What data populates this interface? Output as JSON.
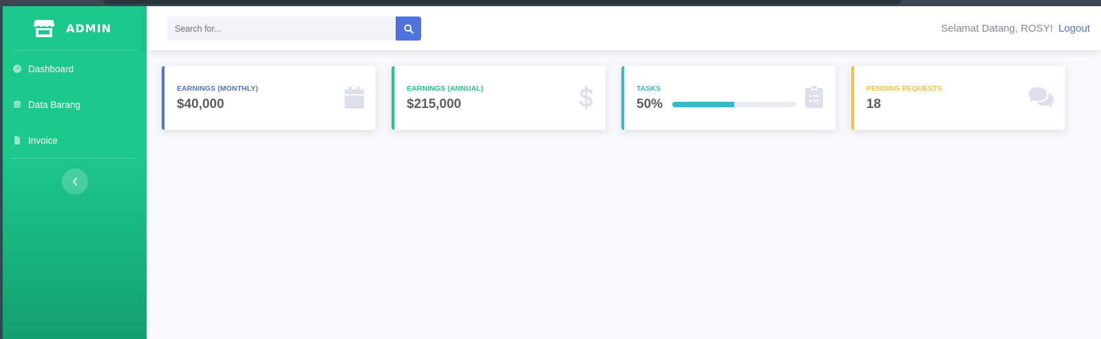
{
  "sidebar": {
    "brand": "ADMIN",
    "brand_icon": "store-icon",
    "items": [
      {
        "label": "Dashboard",
        "icon": "tachometer-icon"
      },
      {
        "label": "Data Barang",
        "icon": "database-icon"
      },
      {
        "label": "Invoice",
        "icon": "file-icon"
      }
    ],
    "toggle_icon": "chevron-left-icon",
    "gradient_colors": [
      "#1cc88a",
      "#13a06e"
    ]
  },
  "topbar": {
    "search": {
      "placeholder": "Search for...",
      "value": "",
      "icon": "search-icon"
    },
    "welcome": "Selamat Datang, ROSY!",
    "logout": "Logout"
  },
  "cards": [
    {
      "label": "Earnings (Monthly)",
      "value": "$40,000",
      "color": "#4e73df",
      "icon": "calendar-icon"
    },
    {
      "label": "Earnings (Annual)",
      "value": "$215,000",
      "color": "#1cc88a",
      "icon": "dollar-icon"
    },
    {
      "label": "Tasks",
      "value": "50%",
      "progress": 50,
      "color": "#36b9cc",
      "icon": "clipboard-list-icon"
    },
    {
      "label": "Pending Requests",
      "value": "18",
      "color": "#f6c23e",
      "icon": "comments-icon"
    }
  ],
  "colors": {
    "primary": "#4e73df",
    "icon_muted": "#dddfeb",
    "text": "#5a5c69"
  }
}
